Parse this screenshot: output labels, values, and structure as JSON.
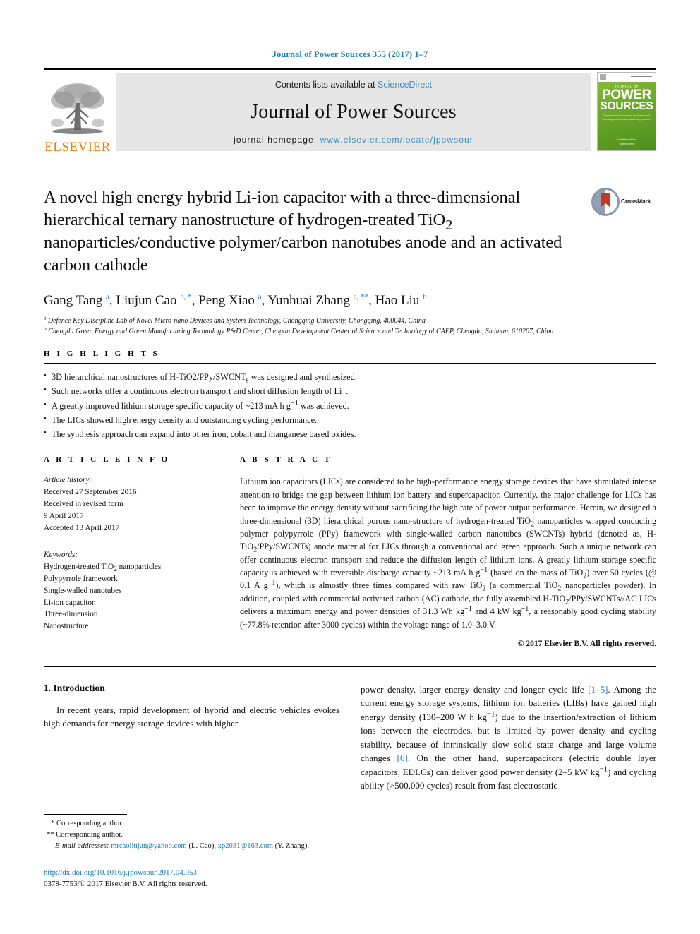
{
  "running_head": "Journal of Power Sources 355 (2017) 1–7",
  "masthead": {
    "contents_prefix": "Contents lists available at ",
    "sciencedirect": "ScienceDirect",
    "journal_name": "Journal of Power Sources",
    "homepage_prefix": "journal homepage: ",
    "homepage_url": "www.elsevier.com/locate/jpowsour",
    "publisher_wordmark": "ELSEVIER",
    "cover": {
      "kicker": "JOURNAL OF",
      "line1": "POWER",
      "line2": "SOURCES",
      "subtitle": "The international journal on the science and technology of electrochemical energy systems",
      "footer": "Available online at\nScienceDirect"
    },
    "colors": {
      "link": "#3a8fc4",
      "box_bg": "#e6e6e6",
      "elsevier_orange": "#ef8200",
      "cover_green": "#6faa2c"
    }
  },
  "crossmark": {
    "label": "CrossMark"
  },
  "title": "A novel high energy hybrid Li-ion capacitor with a three-dimensional hierarchical ternary nanostructure of hydrogen-treated TiO2 nanoparticles/conductive polymer/carbon nanotubes anode and an activated carbon cathode",
  "authors_html": "Gang Tang <sup>a</sup>, Liujun Cao <sup>b, *</sup>, Peng Xiao <sup>a</sup>, Yunhuai Zhang <sup>a, **</sup>, Hao Liu <sup>b</sup>",
  "affiliations": [
    "a Defence Key Discipline Lab of Novel Micro-nano Devices and System Technology, Chongqing University, Chongqing, 400044, China",
    "b Chengdu Green Energy and Green Manufacturing Technology R&D Center, Chengdu Development Center of Science and Technology of CAEP, Chengdu, Sichuan, 610207, China"
  ],
  "highlights": {
    "heading": "H I G H L I G H T S",
    "items": [
      "3D hierarchical nanostructures of H-TiO2/PPy/SWCNTs was designed and synthesized.",
      "Such networks offer a continuous electron transport and short diffusion length of Li+.",
      "A greatly improved lithium storage specific capacity of ~213 mA h g−1 was achieved.",
      "The LICs showed high energy density and outstanding cycling performance.",
      "The synthesis approach can expand into other iron, cobalt and manganese based oxides."
    ]
  },
  "article_info": {
    "heading": "A R T I C L E   I N F O",
    "history_label": "Article history:",
    "history_lines": [
      "Received 27 September 2016",
      "Received in revised form",
      "9 April 2017",
      "Accepted 13 April 2017"
    ],
    "keywords_label": "Keywords:",
    "keywords": [
      "Hydrogen-treated TiO2 nanoparticles",
      "Polypyrrole framework",
      "Single-walled nanotubes",
      "Li-ion capacitor",
      "Three-dimension",
      "Nanostructure"
    ]
  },
  "abstract": {
    "heading": "A B S T R A C T",
    "text": "Lithium ion capacitors (LICs) are considered to be high-performance energy storage devices that have stimulated intense attention to bridge the gap between lithium ion battery and supercapacitor. Currently, the major challenge for LICs has been to improve the energy density without sacrificing the high rate of power output performance. Herein, we designed a three-dimensional (3D) hierarchical porous nanostructure of hydrogen-treated TiO2 nanoparticles wrapped conducting polymer polypyrrole (PPy) framework with single-walled carbon nanotubes (SWCNTs) hybrid (denoted as, H-TiO2/PPy/SWCNTs) anode material for LICs through a conventional and green approach. Such a unique network can offer continuous electron transport and reduce the diffusion length of lithium ions. A greatly lithium storage specific capacity is achieved with reversible discharge capacity ~213 mA h g−1 (based on the mass of TiO2) over 50 cycles (@ 0.1 A g−1), which is almostly three times compared with raw TiO2 (a commercial TiO2 nanoparticles powder). In addition, coupled with commercial activated carbon (AC) cathode, the fully assembled H-TiO2/PPy/SWCNTs//AC LICs delivers a maximum energy and power densities of 31.3 Wh kg−1 and 4 kW kg−1, a reasonably good cycling stability (~77.8% retention after 3000 cycles) within the voltage range of 1.0–3.0 V.",
    "rights": "© 2017 Elsevier B.V. All rights reserved."
  },
  "body": {
    "section_number_title": "1. Introduction",
    "left_paragraph": "In recent years, rapid development of hybrid and electric vehicles evokes high demands for energy storage devices with higher",
    "right_paragraph_html": "power density, larger energy density and longer cycle life <span class=\"ref\">[1–5]</span>. Among the current energy storage systems, lithium ion batteries (LIBs) have gained high energy density (130–200 W h kg<sup>−1</sup>) due to the insertion/extraction of lithium ions between the electrodes, but is limited by power density and cycling stability, because of intrinsically slow solid state charge and large volume changes <span class=\"ref\">[6]</span>. On the other hand, supercapacitors (electric double layer capacitors, EDLCs) can deliver good power density (2–5 kW kg<sup>−1</sup>) and cycling ability (&gt;500,000 cycles) result from fast electrostatic"
  },
  "footnotes": {
    "corresponding_1": "* Corresponding author.",
    "corresponding_2": "** Corresponding author.",
    "email_label": "E-mail addresses:",
    "email_1": "mrcaoliujun@yahoo.com",
    "email_1_owner": "(L. Cao),",
    "email_2": "xp2031@163.com",
    "email_2_owner": "(Y. Zhang).",
    "doi": "http://dx.doi.org/10.1016/j.jpowsour.2017.04.053",
    "issn_rights": "0378-7753/© 2017 Elsevier B.V. All rights reserved."
  }
}
